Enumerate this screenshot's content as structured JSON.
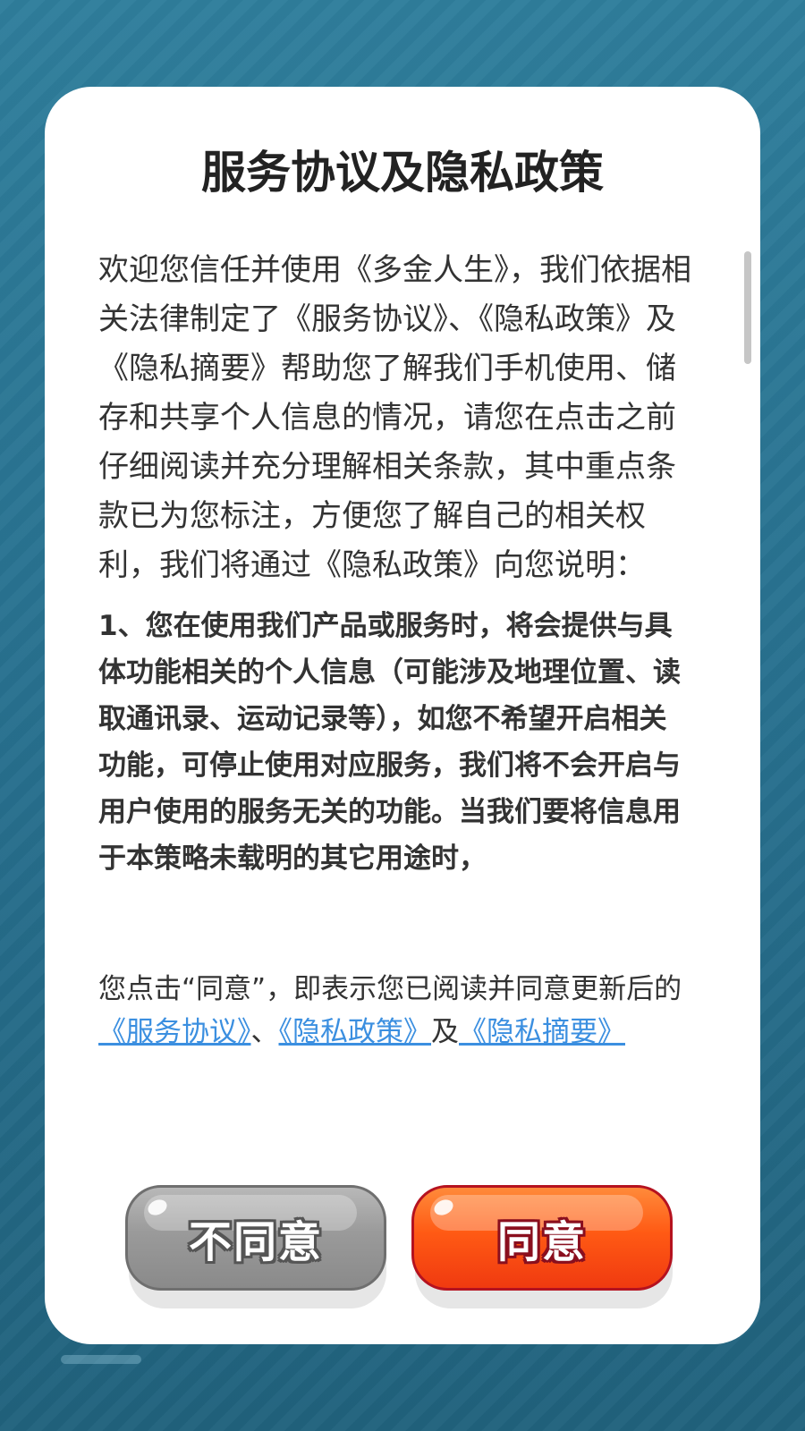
{
  "dialog": {
    "title": "服务协议及隐私政策",
    "intro": "欢迎您信任并使用《多金人生》，我们依据相关法律制定了《服务协议》、《隐私政策》及《隐私摘要》帮助您了解我们手机使用、储存和共享个人信息的情况，请您在点击之前仔细阅读并充分理解相关条款，其中重点条款已为您标注，方便您了解自己的相关权利，我们将通过《隐私政策》向您说明：",
    "point1": "1、您在使用我们产品或服务时，将会提供与具体功能相关的个人信息（可能涉及地理位置、读取通讯录、运动记录等），如您不希望开启相关功能，可停止使用对应服务，我们将不会开启与用户使用的服务无关的功能。当我们要将信息用于本策略未载明的其它用途时，",
    "notice": {
      "prefix": "您点击“同意”，即表示您已阅读并同意更新后的",
      "link_service": "《服务协议》",
      "sep1": "、",
      "link_privacy": "《隐私政策》",
      "sep2": "及",
      "link_summary": "《隐私摘要》"
    },
    "buttons": {
      "disagree": "不同意",
      "agree": "同意"
    }
  },
  "colors": {
    "background": "#2a7694",
    "link": "#3b8fe0",
    "agree_button": "#ff5a14",
    "disagree_button": "#9a9a9a"
  }
}
